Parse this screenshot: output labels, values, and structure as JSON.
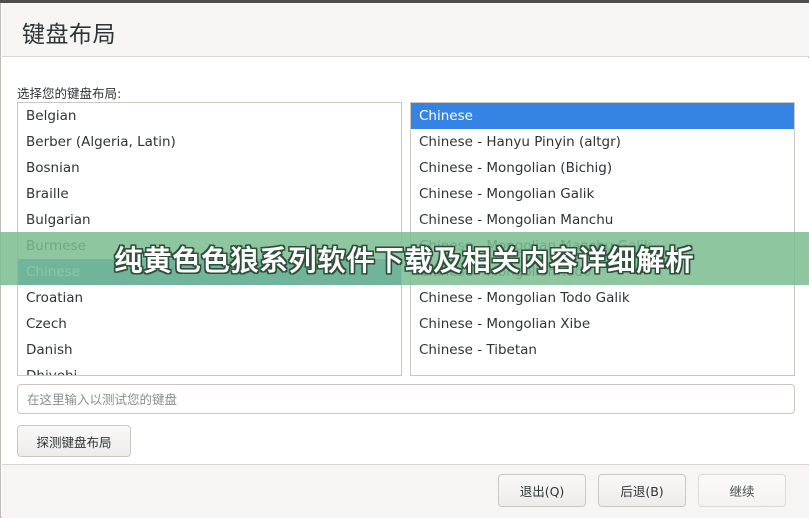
{
  "window": {
    "title": "键盘布局"
  },
  "main": {
    "field_label": "选择您的键盘布局:",
    "layout_list": {
      "items": [
        "Belgian",
        "Berber (Algeria, Latin)",
        "Bosnian",
        "Braille",
        "Bulgarian",
        "Burmese",
        "Chinese",
        "Croatian",
        "Czech",
        "Danish",
        "Dhivehi"
      ],
      "selected": "Chinese"
    },
    "variant_list": {
      "items": [
        "Chinese",
        "Chinese - Hanyu Pinyin (altgr)",
        "Chinese - Mongolian (Bichig)",
        "Chinese - Mongolian Galik",
        "Chinese - Mongolian Manchu",
        "Chinese - Mongolian Manchu Galik",
        "Chinese - Mongolian Todo",
        "Chinese - Mongolian Todo Galik",
        "Chinese - Mongolian Xibe",
        "Chinese - Tibetan"
      ],
      "selected": "Chinese"
    },
    "test_input": {
      "placeholder": "在这里输入以测试您的键盘",
      "value": ""
    },
    "detect_button": "探测键盘布局"
  },
  "footer": {
    "quit_label": "退出(Q)",
    "back_label": "后退(B)",
    "continue_label": "继续"
  },
  "overlay": {
    "banner_text": "纯黄色色狼系列软件下载及相关内容详细解析"
  },
  "colors": {
    "selection_blue": "#3584e4",
    "banner_green": "#7abd8f",
    "header_bg": "#f6f5f4"
  }
}
